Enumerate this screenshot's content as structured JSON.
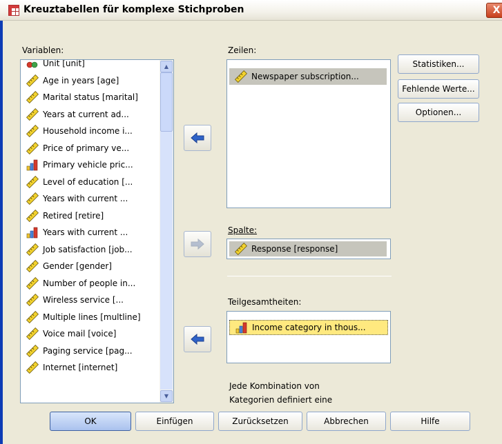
{
  "window": {
    "title": "Kreuztabellen für komplexe Stichproben",
    "close_label": "X"
  },
  "variables": {
    "label": "Variablen:",
    "items": [
      {
        "label": "Unit [unit]",
        "icon": "nominal-icon"
      },
      {
        "label": "Age in years [age]",
        "icon": "scale-ruler-icon"
      },
      {
        "label": "Marital status [marital]",
        "icon": "scale-ruler-icon"
      },
      {
        "label": "Years at current ad...",
        "icon": "scale-ruler-icon"
      },
      {
        "label": "Household income i...",
        "icon": "scale-ruler-icon"
      },
      {
        "label": "Price of primary ve...",
        "icon": "scale-ruler-icon"
      },
      {
        "label": "Primary vehicle pric...",
        "icon": "ordinal-bars-icon"
      },
      {
        "label": "Level of education [...",
        "icon": "scale-ruler-icon"
      },
      {
        "label": "Years with current ...",
        "icon": "scale-ruler-icon"
      },
      {
        "label": "Retired [retire]",
        "icon": "scale-ruler-icon"
      },
      {
        "label": "Years with current ...",
        "icon": "ordinal-bars-icon"
      },
      {
        "label": "Job satisfaction [job...",
        "icon": "scale-ruler-icon"
      },
      {
        "label": "Gender [gender]",
        "icon": "scale-ruler-icon"
      },
      {
        "label": "Number of people in...",
        "icon": "scale-ruler-icon"
      },
      {
        "label": "Wireless service [...",
        "icon": "scale-ruler-icon"
      },
      {
        "label": "Multiple lines [multline]",
        "icon": "scale-ruler-icon"
      },
      {
        "label": "Voice mail [voice]",
        "icon": "scale-ruler-icon"
      },
      {
        "label": "Paging service [pag...",
        "icon": "scale-ruler-icon"
      },
      {
        "label": "Internet [internet]",
        "icon": "scale-ruler-icon"
      }
    ]
  },
  "rows": {
    "label": "Zeilen:",
    "items": [
      {
        "label": "Newspaper subscription...",
        "icon": "scale-ruler-icon"
      }
    ]
  },
  "columns": {
    "label": "Spalte:",
    "items": [
      {
        "label": "Response [response]",
        "icon": "scale-ruler-icon"
      }
    ]
  },
  "subpopulations": {
    "label": "Teilgesamtheiten:",
    "items": [
      {
        "label": "Income category in thous...",
        "icon": "ordinal-bars-icon"
      }
    ]
  },
  "note": {
    "line1": "Jede Kombination von",
    "line2": "Kategorien definiert eine"
  },
  "side_buttons": {
    "statistics": "Statistiken...",
    "missing": "Fehlende Werte...",
    "options": "Optionen..."
  },
  "bottom_buttons": {
    "ok": "OK",
    "paste": "Einfügen",
    "reset": "Zurücksetzen",
    "cancel": "Abbrechen",
    "help": "Hilfe"
  },
  "colors": {
    "selection": "#c6c5bc",
    "selection_yellow": "#ffe97f",
    "title_blue": "#0d3cb5"
  }
}
